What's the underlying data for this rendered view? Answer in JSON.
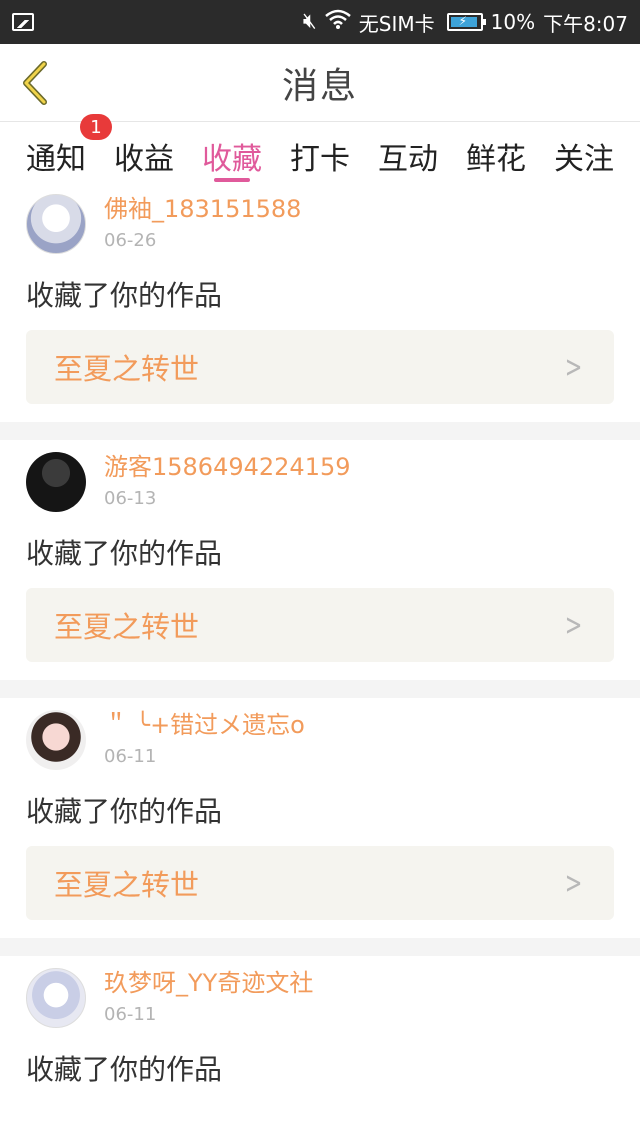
{
  "statusbar": {
    "sim": "无SIM卡",
    "battery": "10%",
    "time": "下午8:07"
  },
  "header": {
    "title": "消息"
  },
  "tabs": [
    {
      "label": "通知",
      "badge": "1"
    },
    {
      "label": "收益"
    },
    {
      "label": "收藏",
      "active": true
    },
    {
      "label": "打卡"
    },
    {
      "label": "互动"
    },
    {
      "label": "鲜花"
    },
    {
      "label": "关注"
    }
  ],
  "feed": [
    {
      "username": "佛袖_183151588",
      "date": "06-26",
      "action": "收藏了你的作品",
      "work": "至夏之转世"
    },
    {
      "username": "游客1586494224159",
      "date": "06-13",
      "action": "收藏了你的作品",
      "work": "至夏之转世"
    },
    {
      "username": "＂ ╰+错过メ遗忘o",
      "date": "06-11",
      "action": "收藏了你的作品",
      "work": "至夏之转世"
    },
    {
      "username": "玖梦呀_YY奇迹文社",
      "date": "06-11",
      "action": "收藏了你的作品"
    }
  ],
  "colors": {
    "accent": "#e05a9b",
    "username": "#f29b5b",
    "badge": "#e83a3a"
  }
}
